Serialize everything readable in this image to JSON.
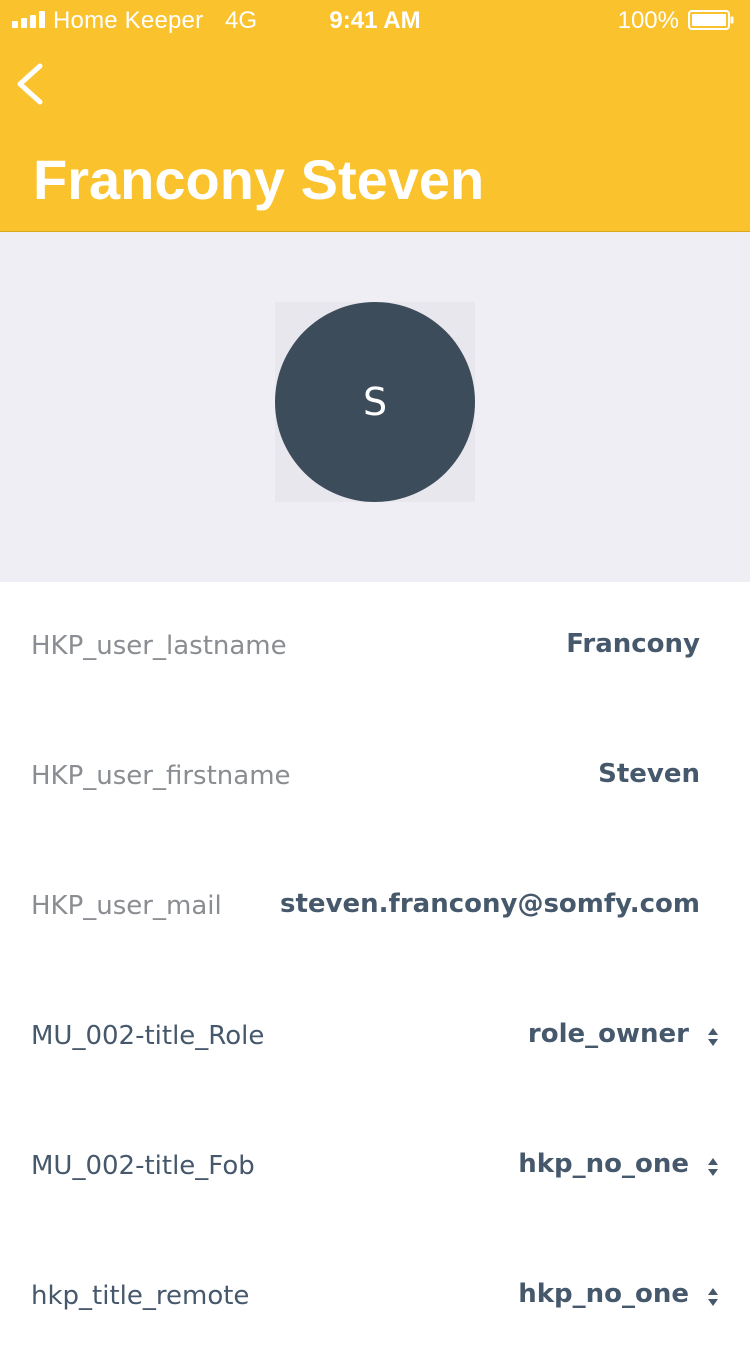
{
  "status_bar": {
    "carrier": "Home Keeper",
    "network": "4G",
    "time": "9:41 AM",
    "battery": "100%"
  },
  "header": {
    "title": "Francony Steven",
    "background_color": "#fac22c"
  },
  "avatar": {
    "initial": "S",
    "color": "#3d4c5b"
  },
  "fields": [
    {
      "label": "HKP_user_lastname",
      "value": "Francony"
    },
    {
      "label": "HKP_user_firstname",
      "value": "Steven"
    },
    {
      "label": "HKP_user_mail",
      "value": "steven.francony@somfy.com"
    },
    {
      "label": "MU_002-title_Role",
      "value": "role_owner"
    },
    {
      "label": "MU_002-title_Fob",
      "value": "hkp_no_one"
    },
    {
      "label": "hkp_title_remote",
      "value": "hkp_no_one"
    }
  ],
  "icons": {
    "back": "chevron-left-icon",
    "selector": "up-down-chevron-icon"
  }
}
